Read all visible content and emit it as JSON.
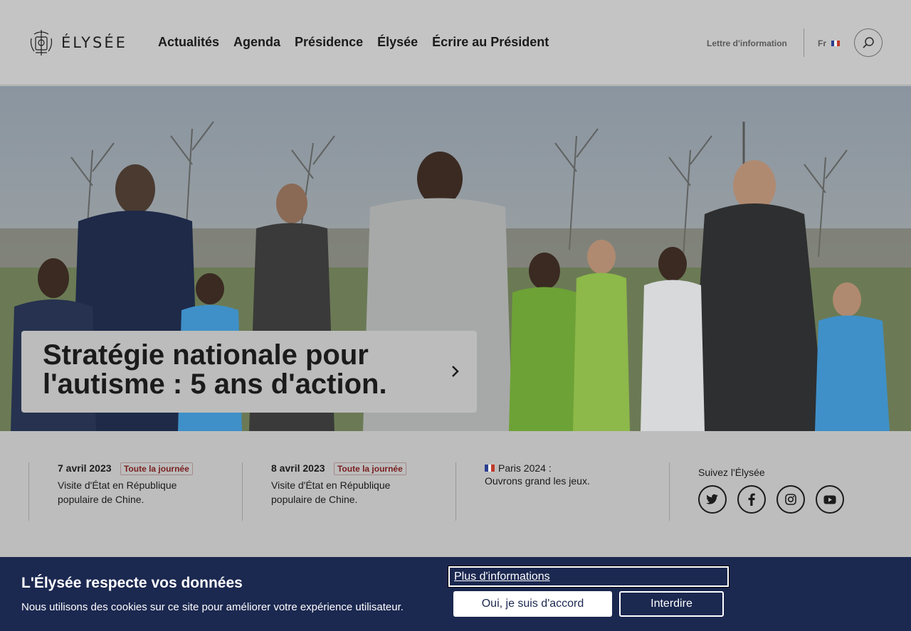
{
  "header": {
    "logo_text": "ÉLYSÉE",
    "nav": [
      "Actualités",
      "Agenda",
      "Présidence",
      "Élysée",
      "Écrire au Président"
    ],
    "newsletter": "Lettre d'information",
    "lang": "Fr"
  },
  "hero": {
    "title": "Stratégie nationale pour l'autisme : 5 ans d'action."
  },
  "events": [
    {
      "date": "7 avril 2023",
      "badge": "Toute la journée",
      "text": "Visite d'État en République populaire de Chine."
    },
    {
      "date": "8 avril 2023",
      "badge": "Toute la journée",
      "text": "Visite d'État en République populaire de Chine."
    }
  ],
  "paris": {
    "line1": "Paris 2024 :",
    "line2": "Ouvrons grand les jeux."
  },
  "social": {
    "title": "Suivez l'Élysée",
    "icons": [
      "twitter-icon",
      "facebook-icon",
      "instagram-icon",
      "youtube-icon"
    ]
  },
  "cookie": {
    "title": "L'Élysée respecte vos données",
    "text": "Nous utilisons des cookies sur ce site pour améliorer votre expérience utilisateur.",
    "more": "Plus d'informations",
    "accept": "Oui, je suis d'accord",
    "deny": "Interdire"
  },
  "colors": {
    "banner": "#1b2850",
    "badge_text": "#7a1f1f",
    "flag_blue": "#2a3f8f",
    "flag_red": "#c0392b"
  }
}
